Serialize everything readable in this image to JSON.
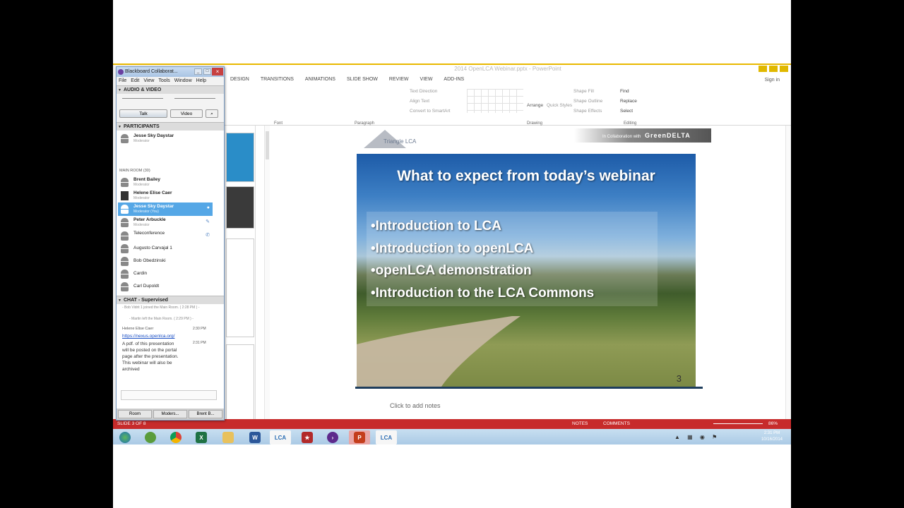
{
  "ppt": {
    "title": "2014 OpenLCA Webinar.pptx - PowerPoint",
    "tabs": [
      "DESIGN",
      "TRANSITIONS",
      "ANIMATIONS",
      "SLIDE SHOW",
      "REVIEW",
      "VIEW",
      "ADD-INS"
    ],
    "signin": "Sign in",
    "ribbon": {
      "font_group": "Font",
      "paragraph_group": "Paragraph",
      "drawing_group": "Drawing",
      "editing_group": "Editing",
      "text_direction": "Text Direction",
      "align_text": "Align Text",
      "convert_smartart": "Convert to SmartArt",
      "arrange": "Arrange",
      "quick_styles": "Quick Styles",
      "shape_fill": "Shape Fill",
      "shape_outline": "Shape Outline",
      "shape_effects": "Shape Effects",
      "find": "Find",
      "replace": "Replace",
      "select": "Select"
    },
    "slide": {
      "logo_text": "Triangle LCA",
      "collab_text": "In Collaboration with",
      "collab_brand": "GreenDELTA",
      "title": "What to expect from today’s webinar",
      "bullets": [
        "•Introduction to LCA",
        "•Introduction to openLCA",
        "•openLCA demonstration",
        "•Introduction to the LCA Commons"
      ],
      "number": "3"
    },
    "notes_placeholder": "Click to add notes",
    "status": {
      "left": "SLIDE 3 OF 8",
      "notes": "NOTES",
      "comments": "COMMENTS",
      "zoom": "86%"
    }
  },
  "bb": {
    "title": "Blackboard Collaborat...",
    "menu": [
      "File",
      "Edit",
      "View",
      "Tools",
      "Window",
      "Help"
    ],
    "audio_video": "AUDIO & VIDEO",
    "talk": "Talk",
    "video": "Video",
    "participants_header": "PARTICIPANTS",
    "me": {
      "name": "Jesse Sky Daystar",
      "role": "Moderator"
    },
    "main_room": "MAIN ROOM (30)",
    "participants": [
      {
        "name": "Brent Bailey",
        "role": "Moderator"
      },
      {
        "name": "Helene Elise Caer",
        "role": "Moderator"
      },
      {
        "name": "Jesse Sky Daystar",
        "role": "Moderator (You)"
      },
      {
        "name": "Peter Arbuckle",
        "role": "Moderator"
      },
      {
        "name": "Teleconference",
        "role": ""
      },
      {
        "name": "Augusto Carvajal 1",
        "role": ""
      },
      {
        "name": "Bob Obedzinski",
        "role": ""
      },
      {
        "name": "Cardin",
        "role": ""
      },
      {
        "name": "Carl Dupoldt",
        "role": ""
      }
    ],
    "chat_header": "CHAT - Supervised",
    "chat": {
      "sys1": "- Bob Vidrit 1 joined the Main Room. ( 2:28 PM ) -",
      "sys2": "- Martin left the Main Room. ( 2:29 PM ) -",
      "sender": "Helene Elise Caer",
      "time1": "2:30 PM",
      "link": "https://nexus.openlca.org/",
      "time2": "2:31 PM",
      "msg": [
        "A pdf. of this presentation",
        "will be posted on the portal",
        "page after the presentation.",
        "This webinar will also be",
        "archived"
      ]
    },
    "tabs": [
      "Room",
      "Moders...",
      "Brent B..."
    ]
  },
  "taskbar": {
    "apps": [
      "start-icon",
      "chrome-icon",
      "excel-icon",
      "folder-icon",
      "word-icon",
      "openlca-icon",
      "powerpoint-icon",
      "blackboard-icon"
    ],
    "lca1": "LCA",
    "lca2": "LCA",
    "time": "2:31 PM",
    "date": "10/16/2014"
  }
}
